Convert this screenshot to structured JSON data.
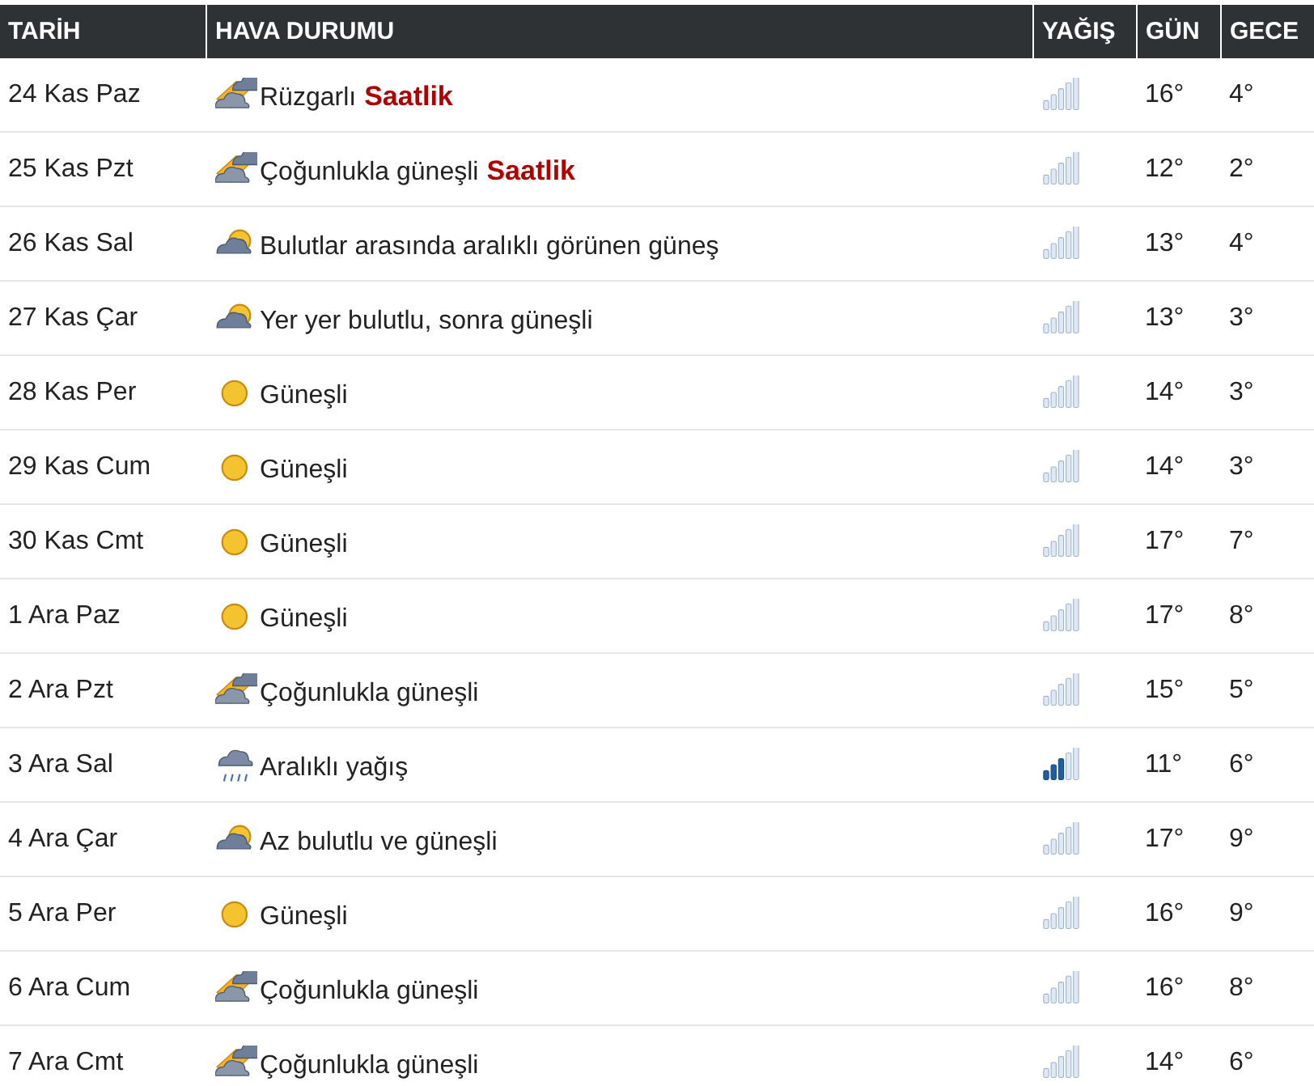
{
  "table": {
    "columns": [
      "TARİH",
      "HAVA DURUMU",
      "YAĞIŞ",
      "GÜN",
      "GECE"
    ],
    "rows": [
      {
        "date": "24 Kas Paz",
        "kind": "windy",
        "condition": "Rüzgarlı",
        "link": "Saatlik",
        "rainy": false,
        "day": "16°",
        "night": "4°"
      },
      {
        "date": "25 Kas Pzt",
        "kind": "windy",
        "condition": "Çoğunlukla güneşli",
        "link": "Saatlik",
        "rainy": false,
        "day": "12°",
        "night": "2°"
      },
      {
        "date": "26 Kas Sal",
        "kind": "cloudsun",
        "condition": "Bulutlar arasında aralıklı görünen güneş",
        "rainy": false,
        "day": "13°",
        "night": "4°"
      },
      {
        "date": "27 Kas Çar",
        "kind": "cloudsun",
        "condition": "Yer yer bulutlu, sonra güneşli",
        "rainy": false,
        "day": "13°",
        "night": "3°"
      },
      {
        "date": "28 Kas Per",
        "kind": "sun",
        "condition": "Güneşli",
        "rainy": false,
        "day": "14°",
        "night": "3°"
      },
      {
        "date": "29 Kas Cum",
        "kind": "sun",
        "condition": "Güneşli",
        "rainy": false,
        "day": "14°",
        "night": "3°"
      },
      {
        "date": "30 Kas Cmt",
        "kind": "sun",
        "condition": "Güneşli",
        "rainy": false,
        "day": "17°",
        "night": "7°"
      },
      {
        "date": "1 Ara Paz",
        "kind": "sun",
        "condition": "Güneşli",
        "rainy": false,
        "day": "17°",
        "night": "8°"
      },
      {
        "date": "2 Ara Pzt",
        "kind": "windy",
        "condition": "Çoğunlukla güneşli",
        "rainy": false,
        "day": "15°",
        "night": "5°"
      },
      {
        "date": "3 Ara Sal",
        "kind": "rain",
        "condition": "Aralıklı yağış",
        "rainy": true,
        "day": "11°",
        "night": "6°"
      },
      {
        "date": "4 Ara Çar",
        "kind": "cloudsun",
        "condition": "Az bulutlu ve güneşli",
        "rainy": false,
        "day": "17°",
        "night": "9°"
      },
      {
        "date": "5 Ara Per",
        "kind": "sun",
        "condition": "Güneşli",
        "rainy": false,
        "day": "16°",
        "night": "9°"
      },
      {
        "date": "6 Ara Cum",
        "kind": "windy",
        "condition": "Çoğunlukla güneşli",
        "rainy": false,
        "day": "16°",
        "night": "8°"
      },
      {
        "date": "7 Ara Cmt",
        "kind": "windy",
        "condition": "Çoğunlukla güneşli",
        "rainy": false,
        "day": "14°",
        "night": "6°"
      }
    ]
  }
}
